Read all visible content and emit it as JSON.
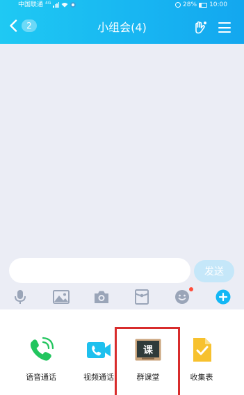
{
  "status_bar": {
    "carrier": "中国联通",
    "network": "4G",
    "battery": "28%",
    "time": "10:00"
  },
  "header": {
    "back_badge": "2",
    "title": "小组会(4)"
  },
  "input": {
    "value": "",
    "placeholder": ""
  },
  "send_button": "发送",
  "toolbar": {
    "icons": [
      "microphone-icon",
      "image-icon",
      "camera-icon",
      "red-packet-icon",
      "emoji-icon",
      "plus-icon"
    ],
    "emoji_has_notification": true
  },
  "panel": {
    "items": [
      {
        "label": "语音通话",
        "icon": "phone-call-icon"
      },
      {
        "label": "视频通话",
        "icon": "video-call-icon"
      },
      {
        "label": "群课堂",
        "icon": "blackboard-icon",
        "icon_text": "课",
        "highlighted": true
      },
      {
        "label": "收集表",
        "icon": "collection-form-icon"
      }
    ]
  },
  "colors": {
    "header_start": "#1fc9f3",
    "header_end": "#13a7ef",
    "chat_background": "#ebedf5",
    "send_button_disabled": "#c5e7f9",
    "toolbar_icon": "#9aa5b8",
    "plus_icon": "#12b7f5",
    "highlight_border": "#d82c2c",
    "phone_green": "#22c55e",
    "video_cyan": "#1ec0ee",
    "form_yellow": "#f7c12e"
  }
}
